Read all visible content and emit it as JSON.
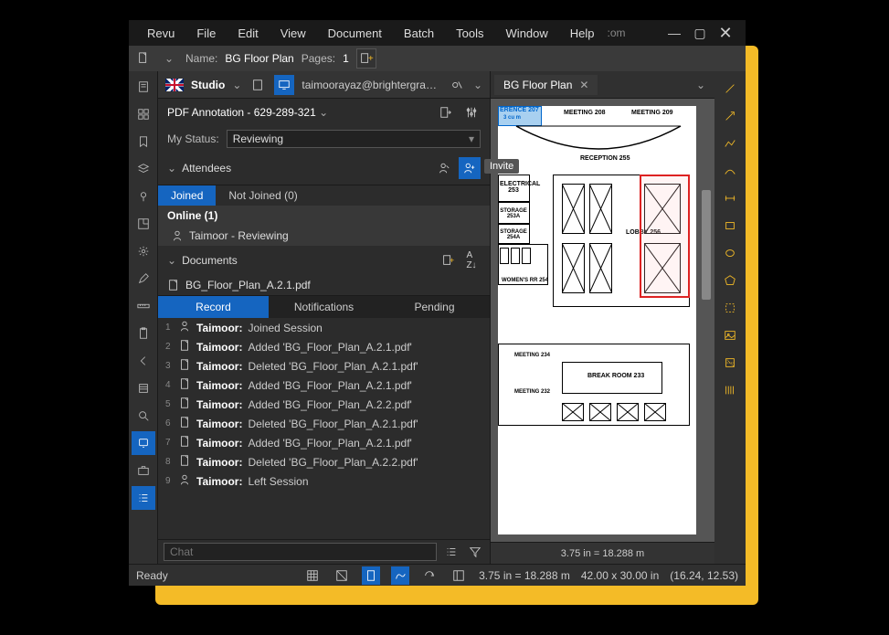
{
  "menubar": {
    "items": [
      "Revu",
      "File",
      "Edit",
      "View",
      "Document",
      "Batch",
      "Tools",
      "Window",
      "Help"
    ],
    "extra": ":om"
  },
  "topbar": {
    "name_label": "Name:",
    "name_value": "BG Floor Plan",
    "pages_label": "Pages:",
    "pages_value": "1"
  },
  "left_rail": [
    "file-icon",
    "grid-icon",
    "bookmark-icon",
    "layers-icon",
    "pin-icon",
    "floorplan-icon",
    "gear-icon",
    "pen-icon",
    "ruler-icon",
    "clipboard-icon",
    "back-icon",
    "book-icon",
    "search-icon",
    "studio-icon",
    "briefcase-icon",
    "list-icon"
  ],
  "studio": {
    "title": "Studio",
    "email": "taimoorayaz@brightergraphics.co...",
    "session": "PDF Annotation - 629-289-321",
    "status_label": "My Status:",
    "status_value": "Reviewing",
    "attendees_title": "Attendees",
    "invite_tooltip": "Invite",
    "tabs": {
      "joined": "Joined",
      "not_joined": "Not Joined (0)"
    },
    "online_label": "Online (1)",
    "attendee": "Taimoor - Reviewing",
    "documents_title": "Documents",
    "document_file": "BG_Floor_Plan_A.2.1.pdf",
    "record_tabs": {
      "record": "Record",
      "notifications": "Notifications",
      "pending": "Pending"
    },
    "activities": [
      {
        "n": "1",
        "user": "Taimoor:",
        "text": "Joined Session"
      },
      {
        "n": "2",
        "user": "Taimoor:",
        "text": "Added 'BG_Floor_Plan_A.2.1.pdf'"
      },
      {
        "n": "3",
        "user": "Taimoor:",
        "text": "Deleted 'BG_Floor_Plan_A.2.1.pdf'"
      },
      {
        "n": "4",
        "user": "Taimoor:",
        "text": "Added 'BG_Floor_Plan_A.2.1.pdf'"
      },
      {
        "n": "5",
        "user": "Taimoor:",
        "text": "Added 'BG_Floor_Plan_A.2.2.pdf'"
      },
      {
        "n": "6",
        "user": "Taimoor:",
        "text": "Deleted 'BG_Floor_Plan_A.2.1.pdf'"
      },
      {
        "n": "7",
        "user": "Taimoor:",
        "text": "Added 'BG_Floor_Plan_A.2.1.pdf'"
      },
      {
        "n": "8",
        "user": "Taimoor:",
        "text": "Deleted 'BG_Floor_Plan_A.2.2.pdf'"
      },
      {
        "n": "9",
        "user": "Taimoor:",
        "text": "Left Session"
      }
    ],
    "chat_placeholder": "Chat"
  },
  "doc_tab": {
    "label": "BG Floor Plan"
  },
  "floorplan": {
    "labels": {
      "reference": "ERENCE 207",
      "sqm": "3 cu m",
      "meeting208": "MEETING 208",
      "meeting209": "MEETING 209",
      "reception": "RECEPTION 255",
      "electrical": "ELECTRICAL 253",
      "storage253a": "STORAGE 253A",
      "storage254a": "STORAGE 254A",
      "lobby": "LOBBY 256",
      "womensrr": "WOMEN'S RR  254",
      "meeting234": "MEETING 234",
      "meeting232": "MEETING 232",
      "breakroom": "BREAK ROOM  233"
    }
  },
  "inner_status": "3.75 in = 18.288 m",
  "statusbar": {
    "ready": "Ready",
    "scale": "3.75 in = 18.288 m",
    "dimensions": "42.00 x 30.00 in",
    "coords": "(16.24, 12.53)"
  },
  "right_rail": [
    "line-tool",
    "arrow-tool",
    "polyline-tool",
    "curve-tool",
    "dimension-tool",
    "rect-tool",
    "ellipse-tool",
    "polygon-tool",
    "crop-tool",
    "image-tool",
    "area-tool",
    "count-tool"
  ]
}
